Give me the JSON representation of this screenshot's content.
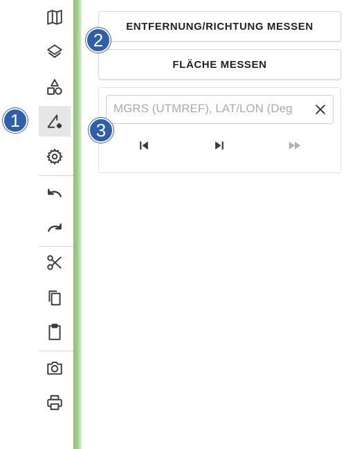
{
  "toolbar": {
    "items": [
      {
        "icon": "map-icon"
      },
      {
        "icon": "layers-icon"
      },
      {
        "icon": "shapes-icon"
      },
      {
        "icon": "measure-tool-icon",
        "active": true
      },
      {
        "icon": "settings-icon"
      },
      {
        "icon": "undo-icon"
      },
      {
        "icon": "redo-icon"
      },
      {
        "icon": "cut-icon"
      },
      {
        "icon": "copy-icon"
      },
      {
        "icon": "paste-icon"
      },
      {
        "icon": "camera-icon"
      },
      {
        "icon": "print-icon"
      }
    ]
  },
  "measure_panel": {
    "distance_button_label": "ENTFERNUNG/RICHTUNG MESSEN",
    "area_button_label": "FLÄCHE MESSEN",
    "coordinate_input": {
      "placeholder": "MGRS (UTMREF), LAT/LON (Deg",
      "value": ""
    },
    "nav_icons": [
      "skip-previous-icon",
      "skip-next-icon",
      "fast-forward-icon"
    ]
  },
  "callouts": [
    "1",
    "2",
    "3"
  ],
  "colors": {
    "callout": "#2f5eab",
    "icon": "#3a3a3a",
    "disabled_icon": "#b0b0b0",
    "active_tool_bg": "#e6e6e6"
  }
}
